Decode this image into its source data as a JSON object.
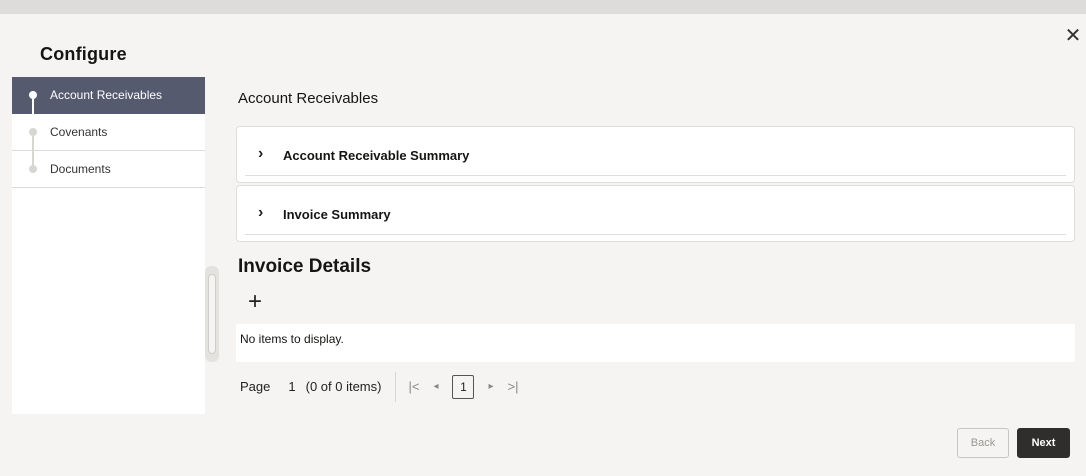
{
  "dialog": {
    "title": "Configure",
    "close_glyph": "✕"
  },
  "nav": {
    "items": [
      {
        "label": "Account Receivables",
        "active": true
      },
      {
        "label": "Covenants",
        "active": false
      },
      {
        "label": "Documents",
        "active": false
      }
    ]
  },
  "main": {
    "section_title": "Account Receivables",
    "accordions": [
      {
        "label": "Account Receivable Summary",
        "chevron": "›"
      },
      {
        "label": "Invoice Summary",
        "chevron": "›"
      }
    ],
    "details_title": "Invoice Details",
    "add_glyph": "+",
    "empty_message": "No items to display."
  },
  "pager": {
    "page_label": "Page",
    "page_value": "1",
    "items_text": "(0 of 0 items)",
    "first_glyph": "|<",
    "prev_glyph": "◂",
    "current_page": "1",
    "next_glyph": "▸",
    "last_glyph": ">|"
  },
  "footer": {
    "back_label": "Back",
    "next_label": "Next"
  },
  "colors": {
    "nav_active_bg": "#555a6e",
    "primary_button": "#2f2e2c",
    "page_bg": "#f5f4f2"
  }
}
